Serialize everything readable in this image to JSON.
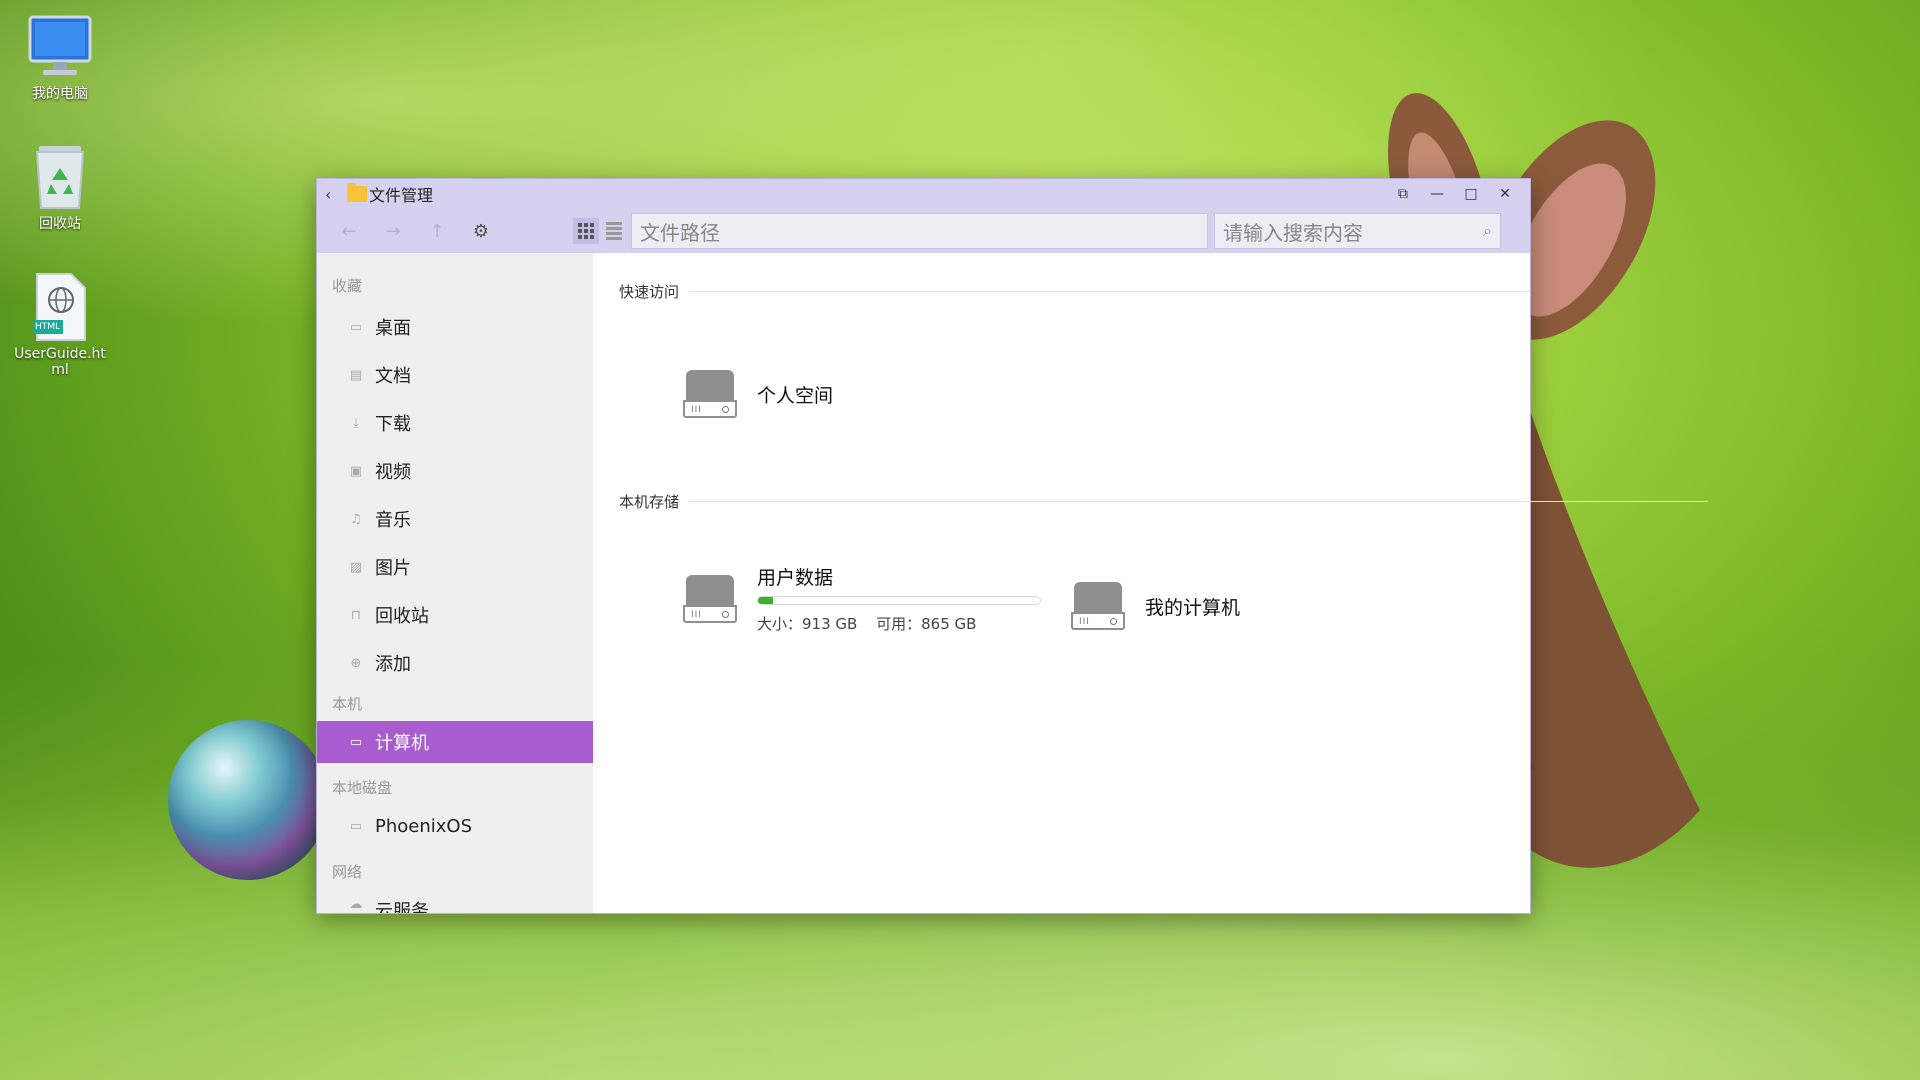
{
  "desktop": {
    "icons": [
      {
        "label": "我的电脑",
        "icon": "monitor-icon"
      },
      {
        "label": "回收站",
        "icon": "recycle-bin-icon"
      },
      {
        "label": "UserGuide.html",
        "icon": "html-file-icon",
        "badge": "HTML"
      }
    ]
  },
  "window": {
    "title": "文件管理",
    "path_placeholder": "文件路径",
    "search_placeholder": "请输入搜索内容",
    "title_buttons": [
      "pin-icon",
      "minimize-icon",
      "maximize-icon",
      "close-icon"
    ]
  },
  "sidebar": {
    "favorites_heading": "收藏",
    "favorites": [
      {
        "label": "桌面",
        "icon": "desktop-icon"
      },
      {
        "label": "文档",
        "icon": "document-icon"
      },
      {
        "label": "下载",
        "icon": "download-icon"
      },
      {
        "label": "视频",
        "icon": "video-icon"
      },
      {
        "label": "音乐",
        "icon": "music-icon"
      },
      {
        "label": "图片",
        "icon": "picture-icon"
      },
      {
        "label": "回收站",
        "icon": "trash-icon"
      },
      {
        "label": "添加",
        "icon": "add-icon"
      }
    ],
    "local_heading": "本机",
    "local": [
      {
        "label": "计算机",
        "icon": "computer-icon",
        "active": true
      }
    ],
    "disks_heading": "本地磁盘",
    "disks": [
      {
        "label": "PhoenixOS",
        "icon": "disk-icon"
      }
    ],
    "network_heading": "网络",
    "network_partial": "云服务"
  },
  "main": {
    "quick_access_heading": "快速访问",
    "quick_access": [
      {
        "name": "个人空间",
        "icon": "hard-drive-icon"
      }
    ],
    "storage_heading": "本机存储",
    "storage": [
      {
        "name": "用户数据",
        "icon": "hard-drive-icon",
        "size": "大小：913 GB",
        "free": "可用：865 GB",
        "used_fraction": 0.053
      },
      {
        "name": "我的计算机",
        "icon": "hard-drive-icon"
      }
    ]
  },
  "colors": {
    "titlebar": "#d5d1ef",
    "active_item": "#a85cd0",
    "usage_bar": "#38b22a"
  }
}
